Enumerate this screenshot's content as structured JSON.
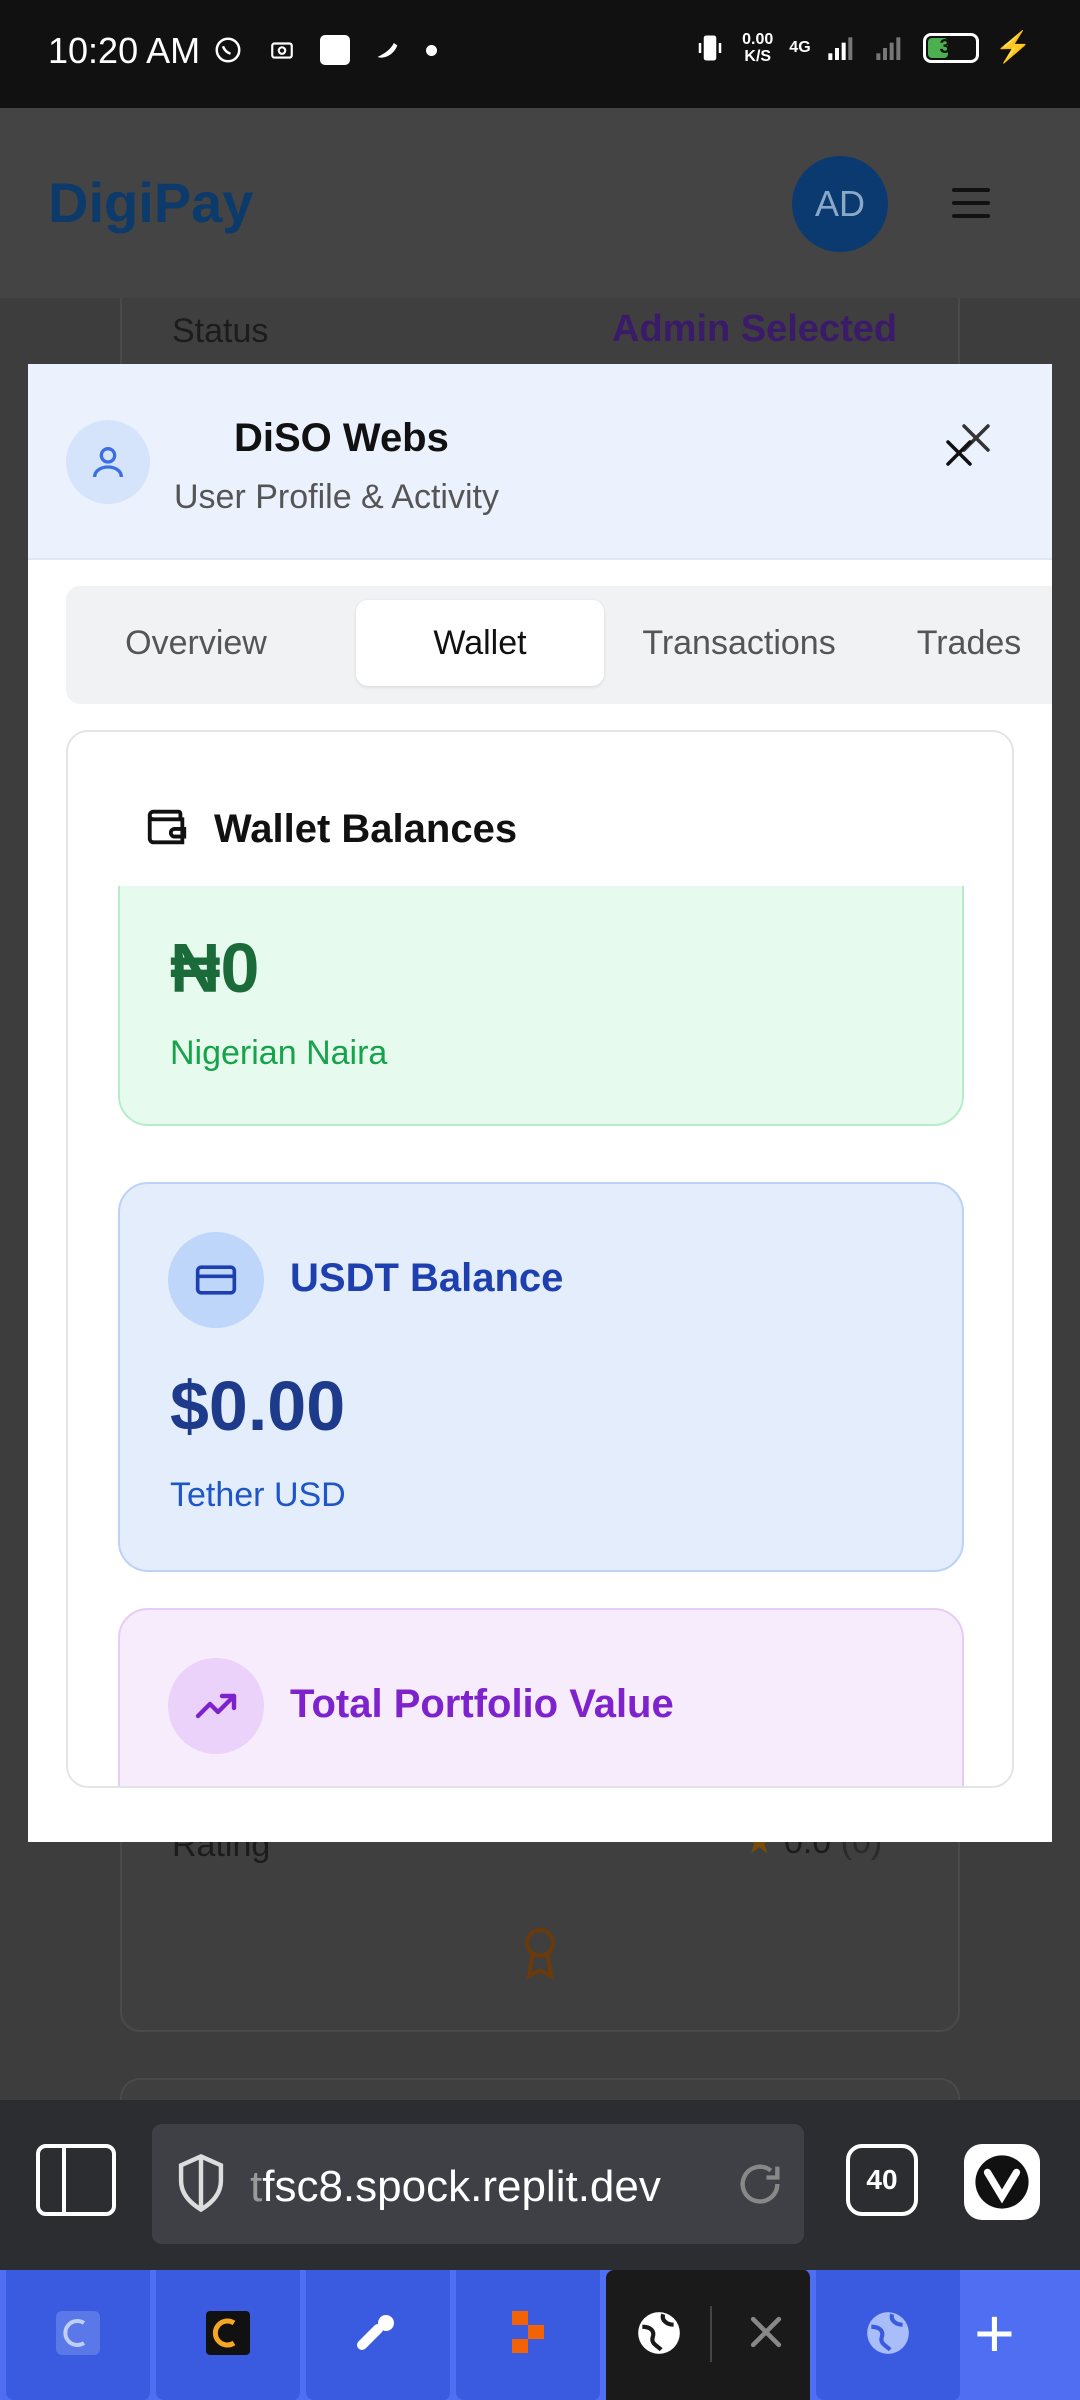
{
  "status_bar": {
    "time": "10:20 AM",
    "net_speed_value": "0.00",
    "net_speed_unit": "K/S",
    "network": "4G",
    "battery": "37"
  },
  "background_app": {
    "brand": "DigiPay",
    "avatar_initials": "AD",
    "status_label": "Status",
    "status_value": "Admin Selected",
    "rating_label": "Rating",
    "rating_value": "0.0",
    "rating_count": "(0)"
  },
  "modal": {
    "user_name": "DiSO Webs",
    "subtitle": "User Profile & Activity",
    "tabs": [
      {
        "label": "Overview",
        "active": false
      },
      {
        "label": "Wallet",
        "active": true
      },
      {
        "label": "Transactions",
        "active": false
      },
      {
        "label": "Trades",
        "active": false
      }
    ],
    "wallet": {
      "title": "Wallet Balances",
      "naira": {
        "amount": "₦0",
        "sub": "Nigerian Naira"
      },
      "usdt": {
        "label": "USDT Balance",
        "amount": "$0.00",
        "sub": "Tether USD"
      },
      "portfolio": {
        "label": "Total Portfolio Value"
      }
    }
  },
  "browser": {
    "url_fade": "t",
    "url": "fsc8.spock.replit.dev",
    "tab_count": "40"
  },
  "colors": {
    "brand_blue": "#0b3a6b",
    "naira_green": "#1b6b3a",
    "usdt_blue": "#1e40af",
    "portfolio_purple": "#7e22ce"
  },
  "icons": [
    "user-icon",
    "close-icon",
    "wallet-icon",
    "credit-card-icon",
    "trending-up-icon",
    "shield-icon",
    "reload-icon",
    "vivaldi-icon",
    "globe-icon",
    "plus-icon"
  ]
}
